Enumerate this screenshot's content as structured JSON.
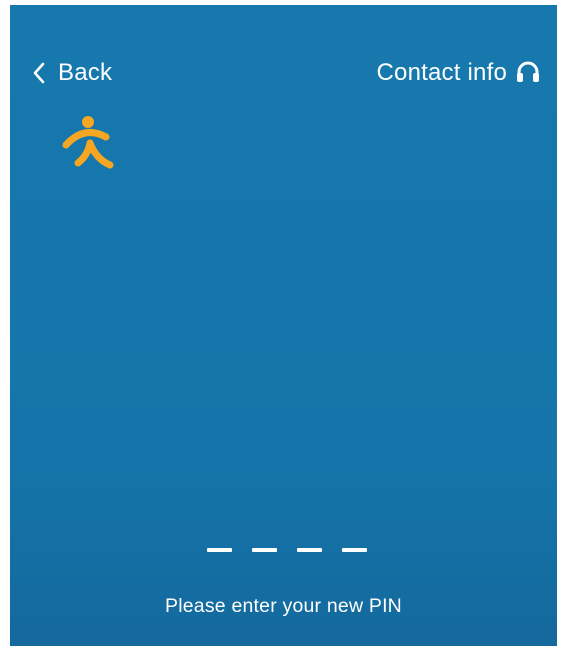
{
  "header": {
    "back_label": "Back",
    "back_icon": "chevron-left-icon",
    "contact_label": "Contact info",
    "contact_icon": "headset-icon"
  },
  "logo": {
    "icon": "running-figure-logo",
    "color": "#f5a623"
  },
  "pin": {
    "length": 4,
    "entered": 0
  },
  "prompt": "Please enter your new PIN",
  "colors": {
    "background": "#1575aa",
    "text": "#ffffff",
    "accent": "#f5a623"
  }
}
